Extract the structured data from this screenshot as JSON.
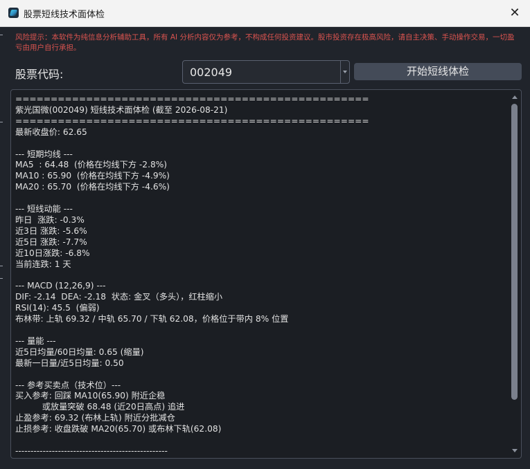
{
  "window": {
    "title": "股票短线技术面体检",
    "close_glyph": "✕"
  },
  "notice": "风险提示：本软件为纯信息分析辅助工具，所有 AI 分析内容仅为参考，不构成任何投资建议。股市投资存在极高风险，请自主决策、手动操作交易，一切盈亏由用户自行承担。",
  "form": {
    "code_label": "股票代码:",
    "code_value": "002049",
    "start_button": "开始短线体检"
  },
  "report": {
    "text": "==================================================\n紫光国微(002049) 短线技术面体检 (截至 2026-08-21)\n==================================================\n最新收盘价: 62.65\n\n--- 短期均线 ---\nMA5  : 64.48  (价格在均线下方 -2.8%)\nMA10 : 65.90  (价格在均线下方 -4.9%)\nMA20 : 65.70  (价格在均线下方 -4.6%)\n\n--- 短线动能 ---\n昨日  涨跌: -0.3%\n近3日 涨跌: -5.6%\n近5日 涨跌: -7.7%\n近10日涨跌: -6.8%\n当前连跌: 1 天\n\n--- MACD (12,26,9) ---\nDIF: -2.14  DEA: -2.18  状态: 金叉（多头），红柱缩小\nRSI(14): 45.5  (偏弱)\n布林带: 上轨 69.32 / 中轨 65.70 / 下轨 62.08，价格位于带内 8% 位置\n\n--- 量能 ---\n近5日均量/60日均量: 0.65 (缩量)\n最新一日量/近5日均量: 0.50\n\n--- 参考买卖点（技术位）---\n买入参考: 回踩 MA10(65.90) 附近企稳\n          或放量突破 68.48 (近20日高点) 追进\n止盈参考: 69.32 (布林上轨) 附近分批减仓\n止损参考: 收盘跌破 MA20(65.70) 或布林下轨(62.08)\n\n--------------------------------------------------"
  },
  "colors": {
    "notice": "#d9534f",
    "background": "#20242b",
    "button": "#444b58"
  },
  "icons": {
    "app": "app-logo-icon",
    "close": "close-icon",
    "combo": "chevron-down-icon"
  }
}
